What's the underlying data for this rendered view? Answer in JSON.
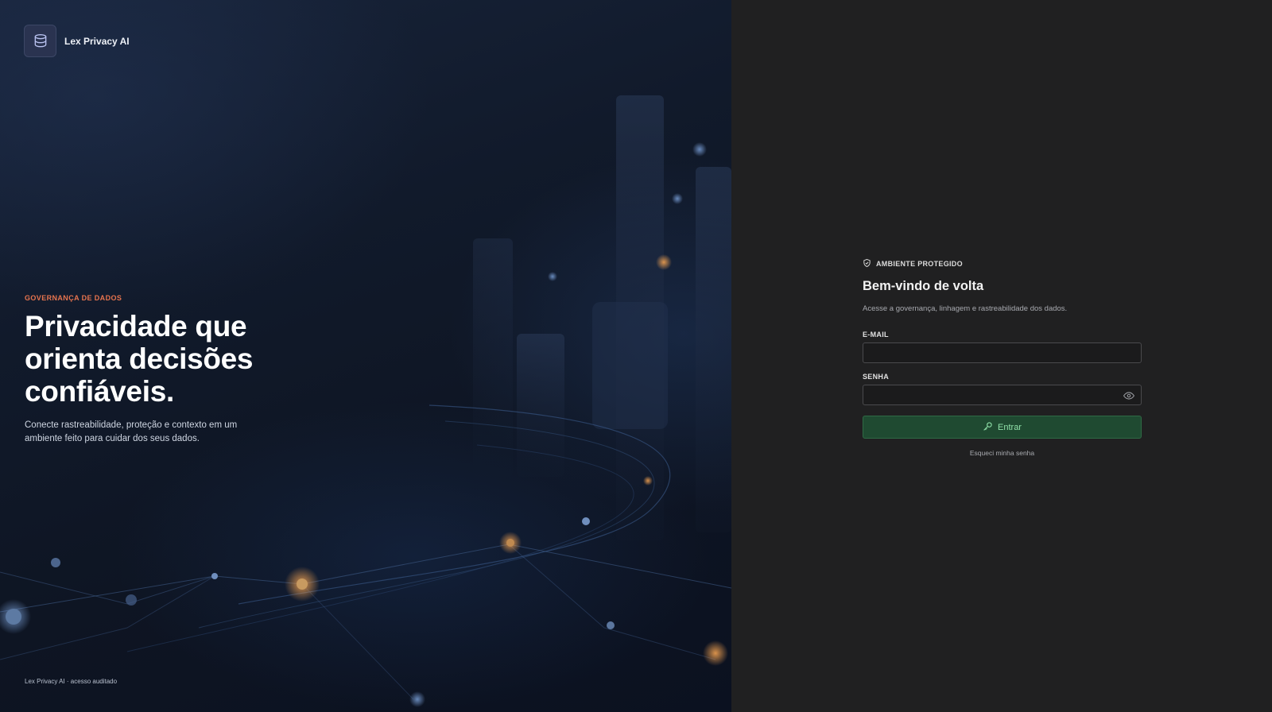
{
  "brand": {
    "name": "Lex Privacy AI",
    "logo_icon": "database-icon"
  },
  "hero": {
    "eyebrow": "GOVERNANÇA DE DADOS",
    "headline_line1": "Privacidade que",
    "headline_line2": "orienta decisões",
    "headline_line3": "confiáveis.",
    "subcopy": "Conecte rastreabilidade, proteção e contexto em um ambiente feito para cuidar dos seus dados.",
    "footer": "Lex Privacy AI · acesso auditado"
  },
  "login": {
    "badge_icon": "shield-icon",
    "badge": "AMBIENTE PROTEGIDO",
    "title": "Bem-vindo de volta",
    "description": "Acesse a governança, linhagem e rastreabilidade dos dados.",
    "email_label": "E-MAIL",
    "email_value": "",
    "password_label": "SENHA",
    "password_value": "",
    "toggle_icon": "eye-icon",
    "submit_icon": "key-icon",
    "submit_label": "Entrar",
    "forgot_label": "Esqueci minha senha"
  },
  "colors": {
    "accent_eyebrow": "#e7744e",
    "button_bg": "#1f4a31",
    "button_text": "#8fe0a8",
    "panel_bg": "#202021"
  }
}
